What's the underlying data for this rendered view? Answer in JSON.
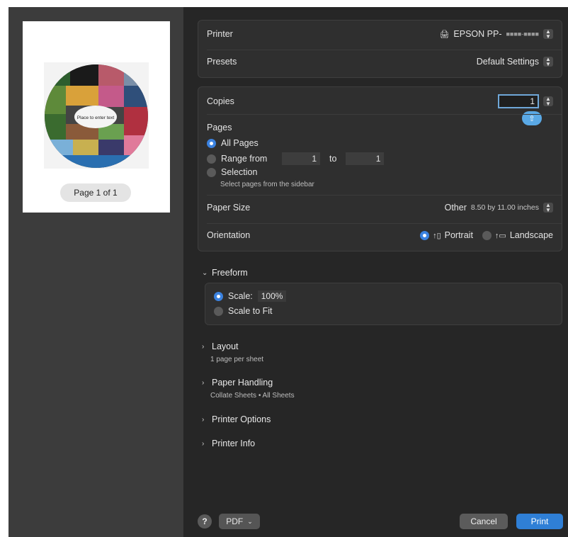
{
  "preview": {
    "disc_text": "Place to enter text",
    "page_label": "Page 1 of 1"
  },
  "printer": {
    "label": "Printer",
    "value": "EPSON PP-",
    "value_redacted": "■■■■‑■■■■"
  },
  "presets": {
    "label": "Presets",
    "value": "Default Settings"
  },
  "copies": {
    "label": "Copies",
    "value": "1"
  },
  "pages": {
    "label": "Pages",
    "all_pages": "All Pages",
    "range_from": "Range from",
    "range_start": "1",
    "to": "to",
    "range_end": "1",
    "selection": "Selection",
    "selection_hint": "Select pages from the sidebar",
    "selected": "All Pages"
  },
  "paper_size": {
    "label": "Paper Size",
    "value": "Other",
    "dimensions": "8.50 by 11.00 inches"
  },
  "orientation": {
    "label": "Orientation",
    "portrait": "Portrait",
    "landscape": "Landscape",
    "selected": "Portrait"
  },
  "freeform": {
    "title": "Freeform",
    "scale_label": "Scale:",
    "scale_value": "100%",
    "scale_to_fit": "Scale to Fit",
    "selected": "Scale"
  },
  "sections": {
    "layout": "Layout",
    "layout_sub": "1 page per sheet",
    "paper_handling": "Paper Handling",
    "paper_handling_sub": "Collate Sheets • All Sheets",
    "printer_options": "Printer Options",
    "printer_info": "Printer Info"
  },
  "footer": {
    "help": "?",
    "pdf": "PDF",
    "cancel": "Cancel",
    "print": "Print"
  },
  "colors": {
    "accent": "#2f7fd6",
    "dialog_bg": "#262626",
    "sidebar_bg": "#3c3c3c"
  }
}
